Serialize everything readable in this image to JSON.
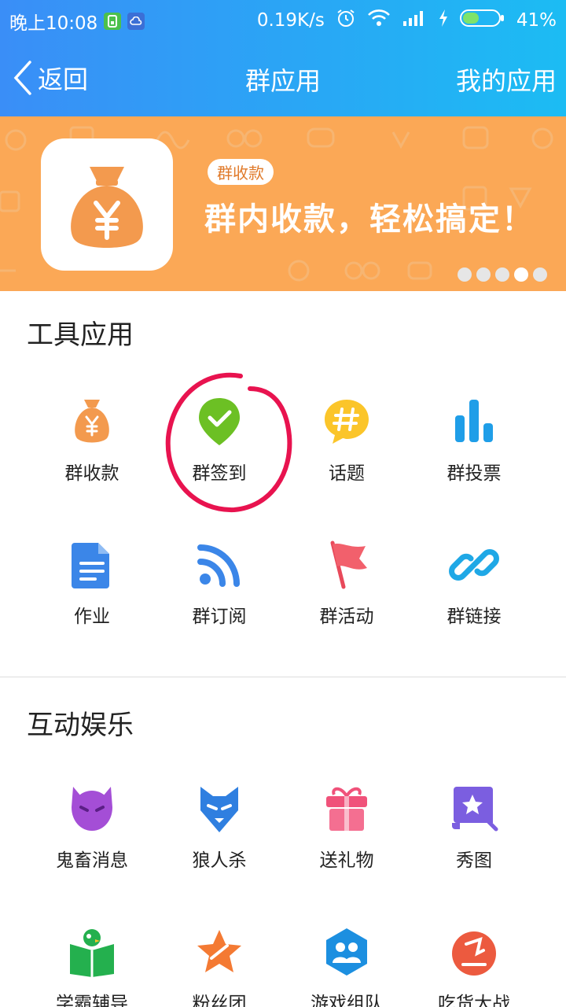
{
  "status": {
    "time": "晚上10:08",
    "speed": "0.19K/s",
    "battery": "41%"
  },
  "nav": {
    "back_label": "返回",
    "title": "群应用",
    "right_label": "我的应用"
  },
  "banner": {
    "tag": "群收款",
    "slogan": "群内收款，轻松搞定！",
    "dots_total": 5,
    "dots_active_index": 3
  },
  "sections": [
    {
      "title": "工具应用",
      "items": [
        {
          "label": "群收款",
          "icon": "money-bag-icon"
        },
        {
          "label": "群签到",
          "icon": "checkin-pin-icon"
        },
        {
          "label": "话题",
          "icon": "topic-hash-icon"
        },
        {
          "label": "群投票",
          "icon": "vote-bars-icon"
        },
        {
          "label": "作业",
          "icon": "homework-doc-icon"
        },
        {
          "label": "群订阅",
          "icon": "rss-icon"
        },
        {
          "label": "群活动",
          "icon": "flag-icon"
        },
        {
          "label": "群链接",
          "icon": "link-icon"
        }
      ]
    },
    {
      "title": "互动娱乐",
      "items": [
        {
          "label": "鬼畜消息",
          "icon": "devil-face-icon"
        },
        {
          "label": "狼人杀",
          "icon": "wolf-icon"
        },
        {
          "label": "送礼物",
          "icon": "gift-icon"
        },
        {
          "label": "秀图",
          "icon": "magic-picture-icon"
        },
        {
          "label": "学霸辅导",
          "icon": "study-book-icon"
        },
        {
          "label": "粉丝团",
          "icon": "fan-star-icon"
        },
        {
          "label": "游戏组队",
          "icon": "team-hexagon-icon"
        },
        {
          "label": "吃货大战",
          "icon": "foodie-icon"
        }
      ]
    }
  ],
  "colors": {
    "topbar_start": "#3a8ef7",
    "topbar_end": "#1cbcf3",
    "banner_bg": "#fba856",
    "annotation_circle": "#e8134f"
  }
}
